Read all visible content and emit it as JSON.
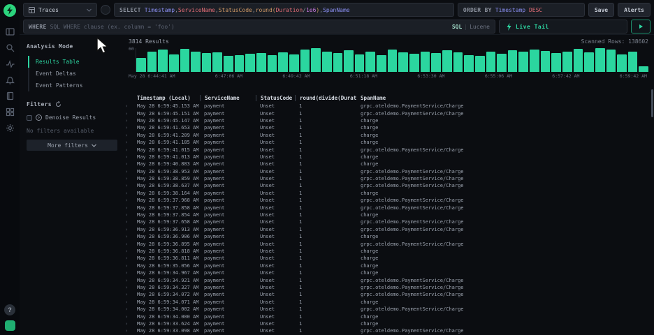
{
  "topbar": {
    "source": {
      "label": "Traces"
    },
    "select": {
      "label": "SELECT",
      "tokens": [
        {
          "t": "Timestamp",
          "c": "#8a8ff2"
        },
        {
          "t": ",",
          "c": "#8b919d"
        },
        {
          "t": "ServiceName",
          "c": "#e06c75"
        },
        {
          "t": ",",
          "c": "#8b919d"
        },
        {
          "t": "StatusCode",
          "c": "#d19a66"
        },
        {
          "t": ",",
          "c": "#8b919d"
        },
        {
          "t": "round(",
          "c": "#d19a66"
        },
        {
          "t": "Duration",
          "c": "#e06c75"
        },
        {
          "t": "/",
          "c": "#8b919d"
        },
        {
          "t": "1e6",
          "c": "#c678dd"
        },
        {
          "t": ")",
          "c": "#d19a66"
        },
        {
          "t": ",",
          "c": "#8b919d"
        },
        {
          "t": "SpanName",
          "c": "#8a8ff2"
        }
      ]
    },
    "orderby": {
      "label": "ORDER BY",
      "tokens": [
        {
          "t": "Timestamp",
          "c": "#8a8ff2"
        },
        {
          "t": " DESC",
          "c": "#e06c75"
        }
      ]
    },
    "save_label": "Save",
    "alerts_label": "Alerts"
  },
  "where_row": {
    "label": "WHERE",
    "placeholder": "SQL WHERE clause (ex. column = 'foo')",
    "sql_label": "SQL",
    "lucene_label": "Lucene",
    "live_tail_label": "Live Tail"
  },
  "sidebar": {
    "analysis_mode_label": "Analysis Mode",
    "items": [
      {
        "label": "Results Table",
        "active": true
      },
      {
        "label": "Event Deltas",
        "active": false
      },
      {
        "label": "Event Patterns",
        "active": false
      }
    ],
    "filters_label": "Filters",
    "denoise_label": "Denoise Results",
    "no_filters_label": "No filters available",
    "more_filters_label": "More filters"
  },
  "results": {
    "count_label": "3814 Results",
    "scanned_label": "Scanned Rows: 138602"
  },
  "chart_data": {
    "type": "bar",
    "title": "",
    "xlabel": "",
    "ylabel": "",
    "ylim": [
      0,
      60
    ],
    "yticks": [
      "60"
    ],
    "bar_color": "#2bd69f",
    "x_labels": [
      "May 28 6:44:41 AM",
      "6:47:06 AM",
      "6:49:42 AM",
      "6:51:18 AM",
      "6:53:30 AM",
      "6:55:06 AM",
      "6:57:42 AM",
      "6:59:42 AM"
    ],
    "values": [
      36,
      52,
      57,
      44,
      58,
      51,
      47,
      50,
      40,
      43,
      46,
      48,
      42,
      50,
      45,
      57,
      60,
      51,
      47,
      55,
      45,
      52,
      43,
      57,
      50,
      46,
      51,
      48,
      55,
      50,
      43,
      40,
      52,
      46,
      55,
      51,
      57,
      53,
      47,
      51,
      58,
      50,
      60,
      56,
      45,
      52,
      14
    ]
  },
  "table": {
    "headers": [
      "Timestamp (Local)",
      "ServiceName",
      "StatusCode",
      "round(divide(Duration,",
      "SpanName"
    ],
    "rows": [
      [
        "May 28 6:59:45.153 AM",
        "payment",
        "Unset",
        "1",
        "grpc.oteldemo.PaymentService/Charge"
      ],
      [
        "May 28 6:59:45.151 AM",
        "payment",
        "Unset",
        "1",
        "grpc.oteldemo.PaymentService/Charge"
      ],
      [
        "May 28 6:59:45.147 AM",
        "payment",
        "Unset",
        "1",
        "charge"
      ],
      [
        "May 28 6:59:41.653 AM",
        "payment",
        "Unset",
        "1",
        "charge"
      ],
      [
        "May 28 6:59:41.209 AM",
        "payment",
        "Unset",
        "1",
        "charge"
      ],
      [
        "May 28 6:59:41.185 AM",
        "payment",
        "Unset",
        "1",
        "charge"
      ],
      [
        "May 28 6:59:41.015 AM",
        "payment",
        "Unset",
        "1",
        "grpc.oteldemo.PaymentService/Charge"
      ],
      [
        "May 28 6:59:41.013 AM",
        "payment",
        "Unset",
        "1",
        "charge"
      ],
      [
        "May 28 6:59:40.883 AM",
        "payment",
        "Unset",
        "1",
        "charge"
      ],
      [
        "May 28 6:59:38.953 AM",
        "payment",
        "Unset",
        "1",
        "grpc.oteldemo.PaymentService/Charge"
      ],
      [
        "May 28 6:59:38.859 AM",
        "payment",
        "Unset",
        "1",
        "grpc.oteldemo.PaymentService/Charge"
      ],
      [
        "May 28 6:59:38.637 AM",
        "payment",
        "Unset",
        "1",
        "grpc.oteldemo.PaymentService/Charge"
      ],
      [
        "May 28 6:59:38.164 AM",
        "payment",
        "Unset",
        "1",
        "charge"
      ],
      [
        "May 28 6:59:37.968 AM",
        "payment",
        "Unset",
        "1",
        "grpc.oteldemo.PaymentService/Charge"
      ],
      [
        "May 28 6:59:37.858 AM",
        "payment",
        "Unset",
        "1",
        "grpc.oteldemo.PaymentService/Charge"
      ],
      [
        "May 28 6:59:37.854 AM",
        "payment",
        "Unset",
        "1",
        "charge"
      ],
      [
        "May 28 6:59:37.658 AM",
        "payment",
        "Unset",
        "1",
        "grpc.oteldemo.PaymentService/Charge"
      ],
      [
        "May 28 6:59:36.913 AM",
        "payment",
        "Unset",
        "1",
        "grpc.oteldemo.PaymentService/Charge"
      ],
      [
        "May 28 6:59:36.906 AM",
        "payment",
        "Unset",
        "1",
        "charge"
      ],
      [
        "May 28 6:59:36.895 AM",
        "payment",
        "Unset",
        "1",
        "grpc.oteldemo.PaymentService/Charge"
      ],
      [
        "May 28 6:59:36.818 AM",
        "payment",
        "Unset",
        "1",
        "charge"
      ],
      [
        "May 28 6:59:36.811 AM",
        "payment",
        "Unset",
        "1",
        "charge"
      ],
      [
        "May 28 6:59:35.056 AM",
        "payment",
        "Unset",
        "1",
        "charge"
      ],
      [
        "May 28 6:59:34.967 AM",
        "payment",
        "Unset",
        "1",
        "charge"
      ],
      [
        "May 28 6:59:34.921 AM",
        "payment",
        "Unset",
        "1",
        "grpc.oteldemo.PaymentService/Charge"
      ],
      [
        "May 28 6:59:34.327 AM",
        "payment",
        "Unset",
        "1",
        "grpc.oteldemo.PaymentService/Charge"
      ],
      [
        "May 28 6:59:34.072 AM",
        "payment",
        "Unset",
        "1",
        "grpc.oteldemo.PaymentService/Charge"
      ],
      [
        "May 28 6:59:34.071 AM",
        "payment",
        "Unset",
        "1",
        "charge"
      ],
      [
        "May 28 6:59:34.002 AM",
        "payment",
        "Unset",
        "1",
        "grpc.oteldemo.PaymentService/Charge"
      ],
      [
        "May 28 6:59:34.000 AM",
        "payment",
        "Unset",
        "1",
        "charge"
      ],
      [
        "May 28 6:59:33.624 AM",
        "payment",
        "Unset",
        "1",
        "charge"
      ],
      [
        "May 28 6:59:33.098 AM",
        "payment",
        "Unset",
        "1",
        "grpc.oteldemo.PaymentService/Charge"
      ]
    ]
  },
  "icons": {
    "logo": "lightning-bolt-icon",
    "rail": [
      "panels-icon",
      "search-icon",
      "pulse-chart-icon",
      "bell-icon",
      "book-icon",
      "grid-icon",
      "gear-icon"
    ],
    "rail_bottom": [
      "help-icon",
      "user-badge-icon"
    ],
    "source": "table-icon",
    "source_chevron": "chevron-down-icon",
    "live_tail": "lightning-icon",
    "run": "play-icon",
    "filters": "refresh-icon",
    "denoise": "denoise-icon",
    "more_filters": "chevron-down-icon",
    "row": "chevron-right-icon"
  },
  "colors": {
    "accent_teal": "#2dd4a0",
    "bar_teal": "#2bd69f",
    "background": "#0b0d11",
    "panel": "#1b1f26",
    "logo_green": "#2bd47d"
  }
}
